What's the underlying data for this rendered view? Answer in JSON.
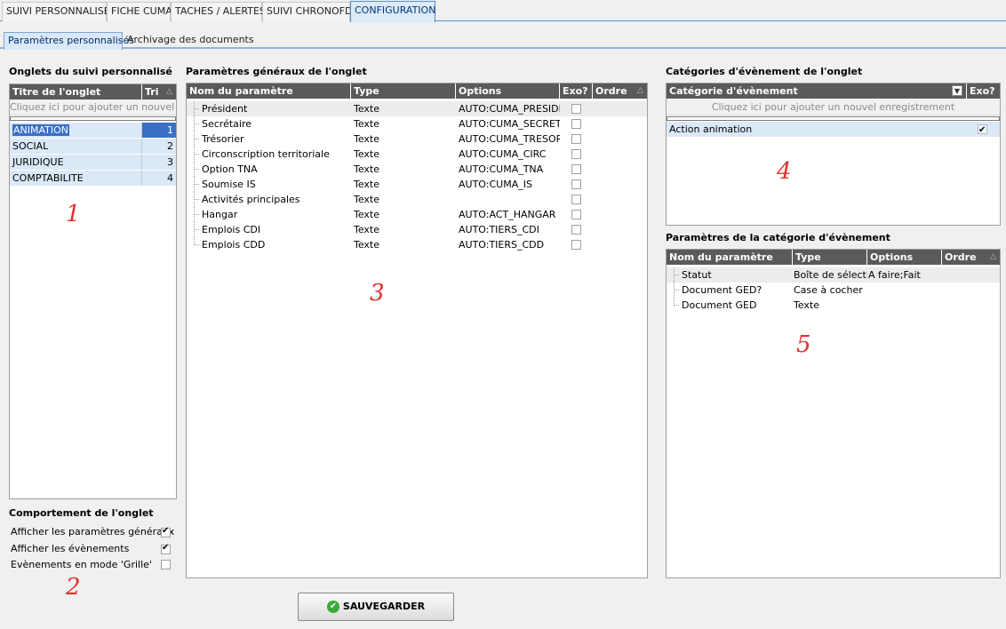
{
  "top_tabs": [
    "SUIVI PERSONNALISE",
    "FICHE CUMA",
    "TACHES / ALERTES",
    "SUIVI CHRONOFD",
    "CONFIGURATION"
  ],
  "sub_tabs": [
    "Paramètres personnalisés",
    "Archivage des documents"
  ],
  "onglets": {
    "title": "Onglets du suivi personnalisé",
    "columns": [
      "Titre de l'onglet",
      "Tri"
    ],
    "add_text": "Cliquez ici pour ajouter un nouvel enreg",
    "rows": [
      {
        "name": "ANIMATION",
        "tri": "1"
      },
      {
        "name": "SOCIAL",
        "tri": "2"
      },
      {
        "name": "JURIDIQUE",
        "tri": "3"
      },
      {
        "name": "COMPTABILITE",
        "tri": "4"
      }
    ]
  },
  "comportement": {
    "title": "Comportement de l'onglet",
    "options": [
      {
        "label": "Afficher les paramètres généraux",
        "checked": true
      },
      {
        "label": "Afficher les évènements",
        "checked": true
      },
      {
        "label": "Evènements en mode 'Grille'",
        "checked": false
      }
    ]
  },
  "params_generaux": {
    "title": "Paramètres généraux de l'onglet",
    "columns": [
      "Nom du paramètre",
      "Type",
      "Options",
      "Exo?",
      "Ordre"
    ],
    "rows": [
      {
        "name": "Président",
        "type": "Texte",
        "options": "AUTO:CUMA_PRESIDENT"
      },
      {
        "name": "Secrétaire",
        "type": "Texte",
        "options": "AUTO:CUMA_SECRET"
      },
      {
        "name": "Trésorier",
        "type": "Texte",
        "options": "AUTO:CUMA_TRESORIER"
      },
      {
        "name": "Circonscription territoriale",
        "type": "Texte",
        "options": "AUTO:CUMA_CIRC"
      },
      {
        "name": "Option TNA",
        "type": "Texte",
        "options": "AUTO:CUMA_TNA"
      },
      {
        "name": "Soumise IS",
        "type": "Texte",
        "options": "AUTO:CUMA_IS"
      },
      {
        "name": "Activités principales",
        "type": "Texte",
        "options": ""
      },
      {
        "name": "Hangar",
        "type": "Texte",
        "options": "AUTO:ACT_HANGAR"
      },
      {
        "name": "Emplois CDI",
        "type": "Texte",
        "options": "AUTO:TIERS_CDI"
      },
      {
        "name": "Emplois CDD",
        "type": "Texte",
        "options": "AUTO:TIERS_CDD"
      }
    ]
  },
  "categories": {
    "title": "Catégories d'évènement de l'onglet",
    "columns": [
      "Catégorie d'évènement",
      "Exo?"
    ],
    "add_text": "Cliquez ici pour ajouter un nouvel enregistrement",
    "rows": [
      {
        "name": "Action animation",
        "exo": true
      }
    ]
  },
  "params_categorie": {
    "title": "Paramètres de la catégorie d'évènement",
    "columns": [
      "Nom du paramètre",
      "Type",
      "Options",
      "Ordre"
    ],
    "rows": [
      {
        "name": "Statut",
        "type": "Boîte de sélection",
        "options": "A faire;Fait"
      },
      {
        "name": "Document GED?",
        "type": "Case à cocher",
        "options": ""
      },
      {
        "name": "Document GED",
        "type": "Texte",
        "options": ""
      }
    ]
  },
  "annotations": [
    "1",
    "2",
    "3",
    "4",
    "5"
  ],
  "save_button": "SAUVEGARDER",
  "colors": {
    "header": "#5a5a5a",
    "selected_row": "#dbe8f7",
    "annotation": "#e03030"
  }
}
